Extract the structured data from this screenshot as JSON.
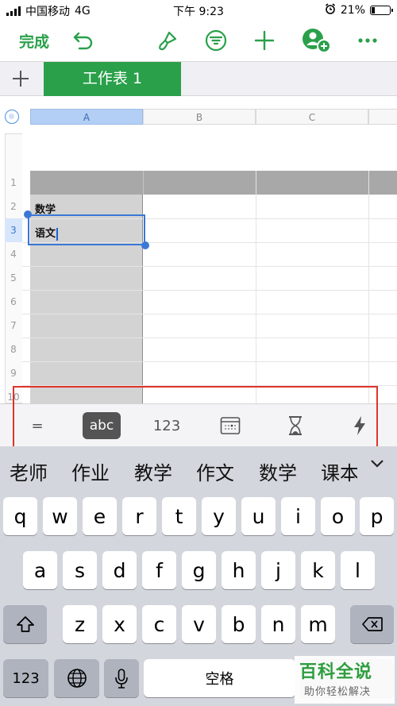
{
  "status_bar": {
    "carrier": "中国移动",
    "network": "4G",
    "time": "下午 9:23",
    "battery": "21%",
    "battery_level": 0.21,
    "alarm_icon": "alarm-clock-icon"
  },
  "toolbar": {
    "done_label": "完成",
    "icons": [
      "undo-icon",
      "paintbrush-icon",
      "filter-icon",
      "add-icon",
      "add-collaborator-icon",
      "more-icon"
    ]
  },
  "sheet_tabs": {
    "add_icon": "plus-icon",
    "tabs": [
      {
        "label": "工作表 1",
        "active": true
      }
    ]
  },
  "spreadsheet": {
    "columns": [
      "A",
      "B",
      "C"
    ],
    "selected_column": "A",
    "rows": [
      "1",
      "2",
      "3",
      "4",
      "5",
      "6",
      "7",
      "8",
      "9",
      "10"
    ],
    "selected_row": "3",
    "cells": {
      "A2": "数学",
      "A3": "语文"
    }
  },
  "input_type_bar": {
    "buttons": [
      {
        "name": "formula",
        "label": "=",
        "active": false
      },
      {
        "name": "text",
        "label": "abc",
        "active": true
      },
      {
        "name": "number",
        "label": "123",
        "active": false
      },
      {
        "name": "date",
        "label": "",
        "icon": "calendar-icon",
        "active": false
      },
      {
        "name": "duration",
        "label": "",
        "icon": "hourglass-icon",
        "active": false
      },
      {
        "name": "quick-formula",
        "label": "",
        "icon": "lightning-icon",
        "active": false
      }
    ],
    "highlight_color": "#e0342b"
  },
  "suggestions": [
    "老师",
    "作业",
    "教学",
    "作文",
    "数学",
    "课本"
  ],
  "keyboard": {
    "row1": [
      "q",
      "w",
      "e",
      "r",
      "t",
      "y",
      "u",
      "i",
      "o",
      "p"
    ],
    "row2": [
      "a",
      "s",
      "d",
      "f",
      "g",
      "h",
      "j",
      "k",
      "l"
    ],
    "row3": [
      "z",
      "x",
      "c",
      "v",
      "b",
      "n",
      "m"
    ],
    "numbers_key": "123",
    "space_label": "空格"
  },
  "watermark": {
    "title": "百科全说",
    "subtitle": "助你轻松解决"
  },
  "colors": {
    "accent": "#2aa04a",
    "selection": "#3a78d6"
  }
}
